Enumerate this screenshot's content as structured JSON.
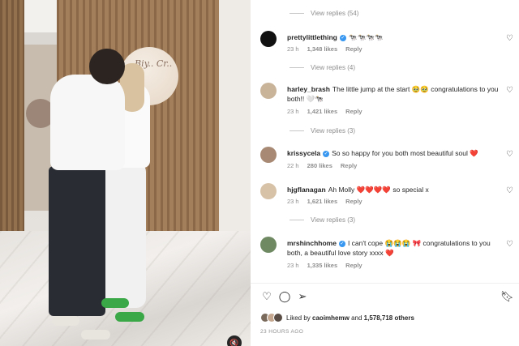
{
  "media": {
    "balloon_text": "Biy.. Cr..",
    "mute_icon": "speaker-mute-icon"
  },
  "comments": {
    "view_replies_top": "View replies (54)",
    "items": [
      {
        "user": "prettylittlething",
        "verified": true,
        "text": "🐄🐄🐄🐄",
        "time": "23 h",
        "likes": "1,348 likes",
        "reply": "Reply",
        "view_replies": "View replies (4)",
        "avatar_color": "#111111"
      },
      {
        "user": "harley_brash",
        "verified": false,
        "text": "The little jump at the start 🥹🥹 congratulations to you both!! 🤍🐄",
        "time": "23 h",
        "likes": "1,421 likes",
        "reply": "Reply",
        "view_replies": "View replies (3)",
        "avatar_color": "#c9b49a"
      },
      {
        "user": "krissycela",
        "verified": true,
        "text": "So so happy for you both most beautiful soul ❤️",
        "time": "22 h",
        "likes": "280 likes",
        "reply": "Reply",
        "view_replies": "",
        "avatar_color": "#a88a74"
      },
      {
        "user": "hjgflanagan",
        "verified": false,
        "text": "Ah Molly ❤️❤️❤️❤️ so special x",
        "time": "23 h",
        "likes": "1,621 likes",
        "reply": "Reply",
        "view_replies": "View replies (3)",
        "avatar_color": "#d7c2a8"
      },
      {
        "user": "mrshinchhome",
        "verified": true,
        "text": "I can't cope 😭😭😭 🎀 congratulations to you both, a beautiful love story xxxx ❤️",
        "time": "23 h",
        "likes": "1,335 likes",
        "reply": "Reply",
        "view_replies": "",
        "avatar_color": "#6f8a63"
      }
    ]
  },
  "actions": {
    "like_icon": "heart-outline-icon",
    "comment_icon": "comment-icon",
    "share_icon": "share-icon",
    "save_icon": "bookmark-icon"
  },
  "likes_summary": {
    "prefix": "Liked by",
    "user": "caoimhemw",
    "middle": "and",
    "count": "1,578,718 others"
  },
  "timestamp": "23 HOURS AGO",
  "colors": {
    "verified": "#3897f0",
    "heart_red": "#ed4956",
    "muted_text": "#8e8e8e"
  }
}
